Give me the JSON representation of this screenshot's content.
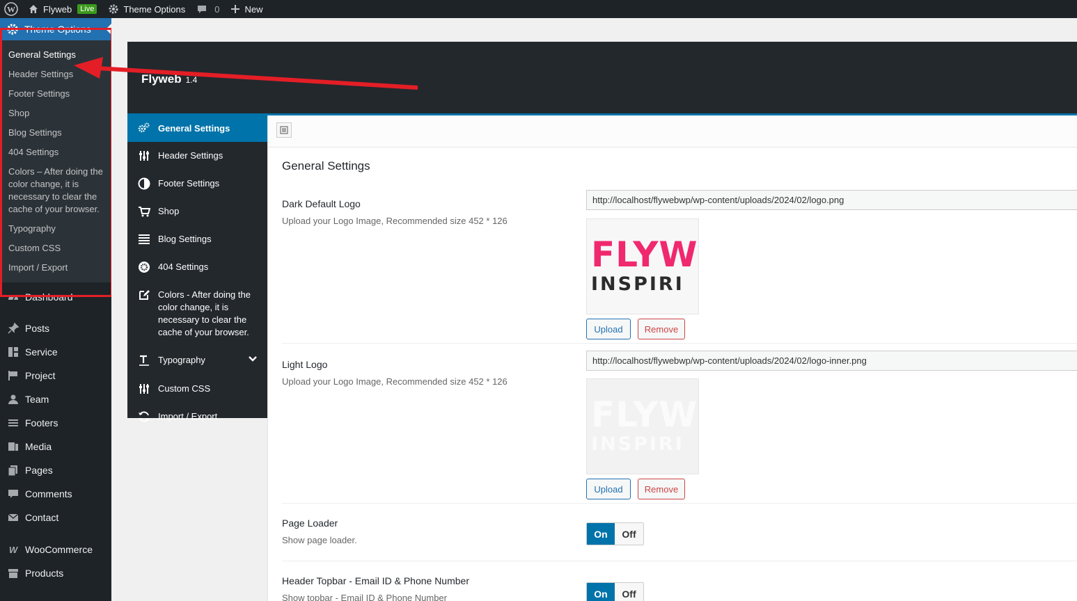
{
  "adminbar": {
    "site_name": "Flyweb",
    "live_badge": "Live",
    "theme_options": "Theme Options",
    "comments_count": "0",
    "new_label": "New"
  },
  "admin_menu": {
    "current": "Theme Options",
    "submenu": [
      "General Settings",
      "Header Settings",
      "Footer Settings",
      "Shop",
      "Blog Settings",
      "404 Settings",
      "Colors – After doing the color change, it is necessary to clear the cache of your browser.",
      "Typography",
      "Custom CSS",
      "Import / Export"
    ],
    "items": [
      {
        "label": "Dashboard",
        "icon": "dashboard-icon"
      },
      {
        "label": "Posts",
        "icon": "pin-icon"
      },
      {
        "label": "Service",
        "icon": "grid-icon"
      },
      {
        "label": "Project",
        "icon": "flag-icon"
      },
      {
        "label": "Team",
        "icon": "user-icon"
      },
      {
        "label": "Footers",
        "icon": "list-icon"
      },
      {
        "label": "Media",
        "icon": "media-icon"
      },
      {
        "label": "Pages",
        "icon": "pages-icon"
      },
      {
        "label": "Comments",
        "icon": "comment-icon"
      },
      {
        "label": "Contact",
        "icon": "mail-icon"
      },
      {
        "label": "WooCommerce",
        "icon": "woo-icon"
      },
      {
        "label": "Products",
        "icon": "archive-icon"
      }
    ]
  },
  "panel": {
    "title": "Flyweb",
    "version": "1.4",
    "section_title": "General Settings"
  },
  "redux_menu": [
    {
      "label": "General Settings",
      "icon": "cogs-icon"
    },
    {
      "label": "Header Settings",
      "icon": "sliders-icon"
    },
    {
      "label": "Footer Settings",
      "icon": "contrast-icon"
    },
    {
      "label": "Shop",
      "icon": "cart-icon"
    },
    {
      "label": "Blog Settings",
      "icon": "list-icon"
    },
    {
      "label": "404 Settings",
      "icon": "gear-circle-icon"
    },
    {
      "label": "Colors - After doing the color change, it is necessary to clear the cache of your browser.",
      "icon": "edit-icon"
    },
    {
      "label": "Typography",
      "icon": "text-icon"
    },
    {
      "label": "Custom CSS",
      "icon": "sliders-icon"
    },
    {
      "label": "Import / Export",
      "icon": "refresh-icon"
    }
  ],
  "fields": {
    "dark_logo": {
      "label": "Dark Default Logo",
      "desc": "Upload your Logo Image, Recommended size 452 * 126",
      "url": "http://localhost/flywebwp/wp-content/uploads/2024/02/logo.png",
      "logo_line1": "FLYW",
      "logo_line2": "INSPIRI"
    },
    "light_logo": {
      "label": "Light Logo",
      "desc": "Upload your Logo Image, Recommended size 452 * 126",
      "url": "http://localhost/flywebwp/wp-content/uploads/2024/02/logo-inner.png",
      "logo_line1": "FLYW",
      "logo_line2": "INSPIRI"
    },
    "page_loader": {
      "label": "Page Loader",
      "desc": "Show page loader."
    },
    "header_topbar": {
      "label": "Header Topbar - Email ID & Phone Number",
      "desc": "Show topbar - Email ID & Phone Number"
    }
  },
  "buttons": {
    "upload": "Upload",
    "remove": "Remove",
    "on": "On",
    "off": "Off"
  },
  "colors": {
    "accent": "#0073aa",
    "admin_dark": "#1d2327",
    "highlight_red": "#e41e26",
    "logo_pink": "#f0286e"
  }
}
